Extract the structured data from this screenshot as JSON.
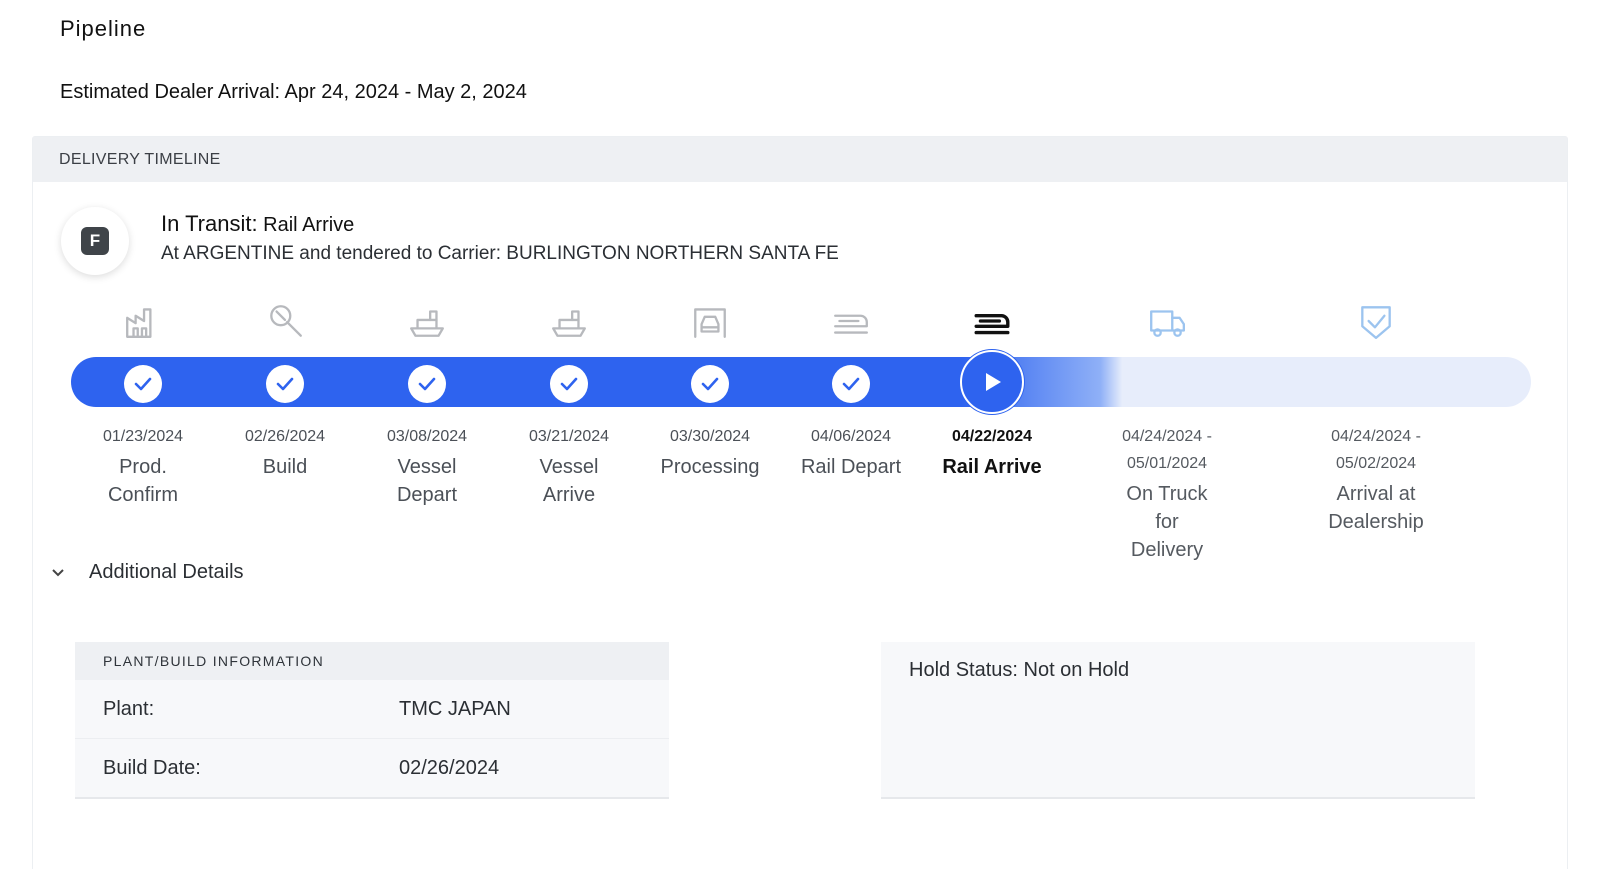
{
  "page": {
    "title": "Pipeline",
    "eta": "Estimated Dealer Arrival: Apr 24, 2024 - May 2, 2024"
  },
  "timeline": {
    "header": "DELIVERY TIMELINE",
    "badge": "F",
    "status_label": "In Transit:",
    "status_value": "Rail Arrive",
    "status_detail": "At ARGENTINE and tendered to Carrier: BURLINGTON NORTHERN SANTA FE",
    "colors": {
      "completed": "#2e63ef",
      "pending": "#e7edfb",
      "future_icon": "#9cc4ef",
      "past_icon": "#b7b9bd"
    },
    "steps": [
      {
        "date": "01/23/2024",
        "label": "Prod. Confirm",
        "state": "completed",
        "icon": "factory-icon"
      },
      {
        "date": "02/26/2024",
        "label": "Build",
        "state": "completed",
        "icon": "wrench-icon"
      },
      {
        "date": "03/08/2024",
        "label": "Vessel Depart",
        "state": "completed",
        "icon": "ship-icon"
      },
      {
        "date": "03/21/2024",
        "label": "Vessel Arrive",
        "state": "completed",
        "icon": "ship-icon"
      },
      {
        "date": "03/30/2024",
        "label": "Processing",
        "state": "completed",
        "icon": "car-icon"
      },
      {
        "date": "04/06/2024",
        "label": "Rail Depart",
        "state": "completed",
        "icon": "railcar-icon"
      },
      {
        "date": "04/22/2024",
        "label": "Rail Arrive",
        "state": "current",
        "icon": "railcar-icon"
      },
      {
        "date": "04/24/2024 - 05/01/2024",
        "label": "On Truck for Delivery",
        "state": "future",
        "icon": "truck-icon"
      },
      {
        "date": "04/24/2024 - 05/02/2024",
        "label": "Arrival at Dealership",
        "state": "future",
        "icon": "shield-check-icon"
      }
    ]
  },
  "details": {
    "toggle_label": "Additional Details",
    "plant_header": "PLANT/BUILD INFORMATION",
    "plant_key": "Plant:",
    "plant_value": "TMC JAPAN",
    "build_key": "Build Date:",
    "build_value": "02/26/2024",
    "hold_status": "Hold Status: Not on Hold"
  }
}
